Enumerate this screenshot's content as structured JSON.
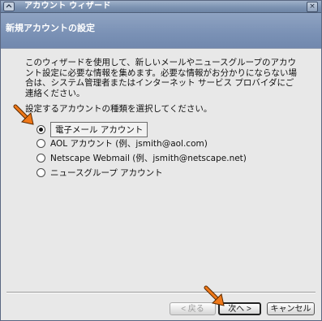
{
  "window": {
    "title": "アカウント ウィザード",
    "close_glyph": "×"
  },
  "header": {
    "title": "新規アカウントの設定"
  },
  "content": {
    "intro": "このウィザードを使用して、新しいメールやニュースグループのアカウント設定に必要な情報を集めます。必要な情報がお分かりにならない場合は、システム管理者またはインターネット サービス プロバイダにご連絡ください。",
    "prompt": "設定するアカウントの種類を選択してください。"
  },
  "account_types": [
    {
      "label": "電子メール アカウント",
      "selected": true
    },
    {
      "label": "AOL アカウント (例、jsmith@aol.com)",
      "selected": false
    },
    {
      "label": "Netscape Webmail (例、jsmith@netscape.net)",
      "selected": false
    },
    {
      "label": "ニュースグループ アカウント",
      "selected": false
    }
  ],
  "buttons": {
    "back": "< 戻る",
    "next": "次へ >",
    "cancel": "キャンセル"
  },
  "colors": {
    "header_bg": "#7a91b5",
    "window_bg": "#e8e8e8",
    "annotation_arrow": "#f07818"
  }
}
